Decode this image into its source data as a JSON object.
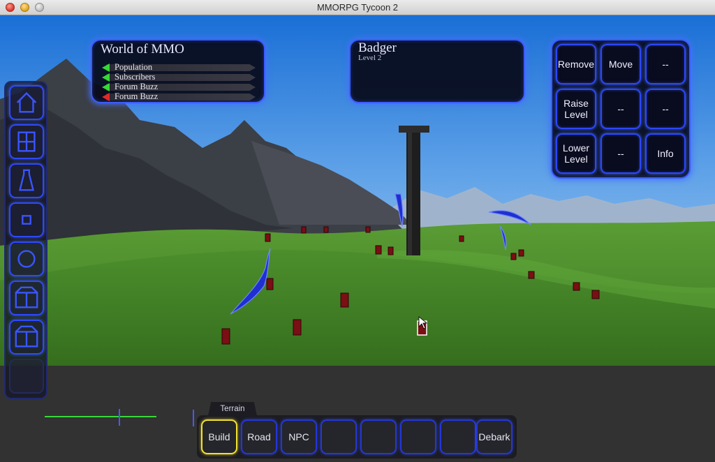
{
  "window": {
    "title": "MMORPG Tycoon 2"
  },
  "stats_panel": {
    "title": "World of MMO",
    "rows": [
      {
        "label": "Population",
        "trend": "up"
      },
      {
        "label": "Subscribers",
        "trend": "up"
      },
      {
        "label": "Forum Buzz",
        "trend": "up"
      },
      {
        "label": "Forum Buzz",
        "trend": "down"
      }
    ]
  },
  "selection_panel": {
    "name": "Badger",
    "level": "Level 2"
  },
  "action_grid": {
    "buttons": [
      {
        "label": "Remove"
      },
      {
        "label": "Move"
      },
      {
        "label": "--"
      },
      {
        "label": "Raise Level"
      },
      {
        "label": "--"
      },
      {
        "label": "--"
      },
      {
        "label": "Lower Level"
      },
      {
        "label": "--"
      },
      {
        "label": "Info"
      }
    ]
  },
  "tool_column": {
    "icons": [
      "home-icon",
      "door-icon",
      "tower-icon",
      "small-square-icon",
      "circle-icon",
      "box-icon",
      "box-icon",
      "empty-slot"
    ]
  },
  "bottom_toolbar": {
    "tab_label": "Terrain",
    "buttons": [
      {
        "label": "Build",
        "active": true
      },
      {
        "label": "Road"
      },
      {
        "label": "NPC"
      },
      {
        "label": ""
      },
      {
        "label": ""
      },
      {
        "label": ""
      },
      {
        "label": ""
      },
      {
        "label": "Debark"
      }
    ]
  },
  "colors": {
    "panel_glow": "#3a5cff",
    "trend_up": "#35d835",
    "trend_down": "#e02828",
    "active_button": "#f0e030",
    "slider": "#3ad83a"
  }
}
